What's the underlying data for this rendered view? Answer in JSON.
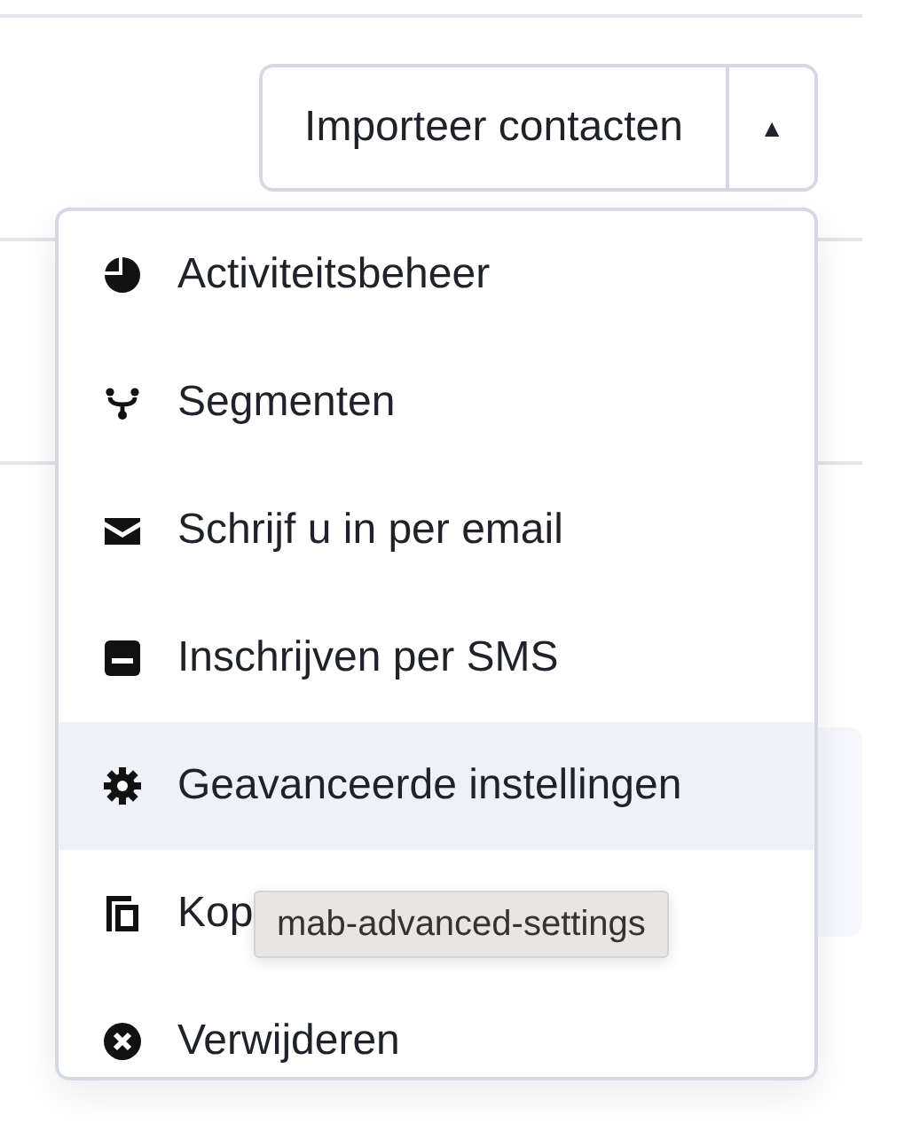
{
  "split_button": {
    "label": "Importeer contacten",
    "caret": "▲"
  },
  "menu": {
    "items": [
      {
        "kind": "pie",
        "label": "Activiteitsbeheer",
        "highlighted": false
      },
      {
        "kind": "fork",
        "label": "Segmenten",
        "highlighted": false
      },
      {
        "kind": "envelope",
        "label": "Schrijf u in per email",
        "highlighted": false
      },
      {
        "kind": "form",
        "label": "Inschrijven per SMS",
        "highlighted": false
      },
      {
        "kind": "gear",
        "label": "Geavanceerde instellingen",
        "highlighted": true
      },
      {
        "kind": "copy",
        "label": "Kop",
        "highlighted": false
      },
      {
        "kind": "delete",
        "label": "Verwijderen",
        "highlighted": false
      }
    ]
  },
  "tooltip": {
    "text": "mab-advanced-settings"
  }
}
